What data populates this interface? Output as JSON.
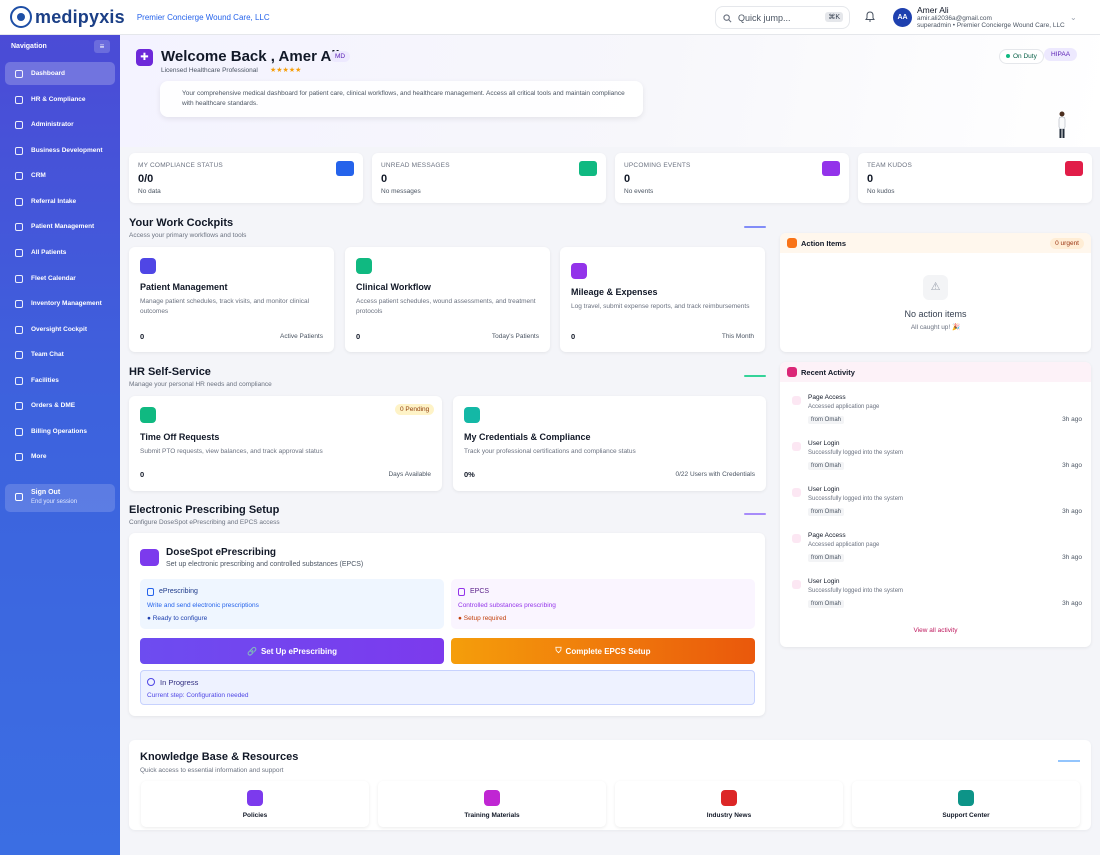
{
  "app": {
    "brand": "medipyxis",
    "org": "Premier Concierge Wound Care, LLC"
  },
  "topbar": {
    "quick_jump_placeholder": "Quick jump...",
    "quick_jump_shortcut": "⌘K",
    "avatar_initials": "AA",
    "user_name": "Amer Ali",
    "user_email": "amir.ali2036a@gmail.com",
    "user_role": "superadmin • Premier Concierge Wound Care, LLC"
  },
  "sidebar": {
    "header": "Navigation",
    "items": [
      {
        "label": "Dashboard",
        "icon": "home-icon"
      },
      {
        "label": "HR & Compliance",
        "icon": "shield-icon"
      },
      {
        "label": "Administrator",
        "icon": "shield-check-icon"
      },
      {
        "label": "Business Development",
        "icon": "trending-up-icon"
      },
      {
        "label": "CRM",
        "icon": "inbox-icon"
      },
      {
        "label": "Referral Intake",
        "icon": "clipboard-icon"
      },
      {
        "label": "Patient Management",
        "icon": "heart-icon"
      },
      {
        "label": "All Patients",
        "icon": "users-icon"
      },
      {
        "label": "Fleet Calendar",
        "icon": "calendar-icon"
      },
      {
        "label": "Inventory Management",
        "icon": "box-icon"
      },
      {
        "label": "Oversight Cockpit",
        "icon": "activity-icon"
      },
      {
        "label": "Team Chat",
        "icon": "chat-icon"
      },
      {
        "label": "Facilities",
        "icon": "building-icon"
      },
      {
        "label": "Orders & DME",
        "icon": "file-icon"
      },
      {
        "label": "Billing Operations",
        "icon": "dollar-icon"
      },
      {
        "label": "More",
        "icon": "more-icon"
      }
    ],
    "sign_out": "Sign Out",
    "sign_out_sub": "End your session"
  },
  "hero": {
    "title": "Welcome Back , Amer Ali!",
    "badge": "MD",
    "subtitle": "Licensed Healthcare Professional",
    "stars": "★★★★★",
    "status": "On Duty",
    "hipaa": "HIPAA",
    "description": "Your comprehensive medical dashboard for patient care, clinical workflows, and healthcare management.",
    "description2": "Access all critical tools and maintain compliance with healthcare standards."
  },
  "stats": [
    {
      "label": "MY COMPLIANCE STATUS",
      "value": "0/0",
      "sub": "No data",
      "color": "#2563eb"
    },
    {
      "label": "UNREAD MESSAGES",
      "value": "0",
      "sub": "No messages",
      "color": "#10b981"
    },
    {
      "label": "UPCOMING EVENTS",
      "value": "0",
      "sub": "No events",
      "color": "#9333ea"
    },
    {
      "label": "TEAM KUDOS",
      "value": "0",
      "sub": "No kudos",
      "color": "#e11d48"
    }
  ],
  "cockpits": {
    "title": "Your Work Cockpits",
    "subtitle": "Access your primary workflows and tools",
    "cards": [
      {
        "title": "Patient Management",
        "desc": "Manage patient schedules, track visits, and monitor clinical outcomes",
        "count": "0",
        "foot": "Active Patients",
        "color": "#4f46e5"
      },
      {
        "title": "Clinical Workflow",
        "desc": "Access patient schedules, wound assessments, and treatment protocols",
        "count": "0",
        "foot": "Today's Patients",
        "color": "#10b981"
      },
      {
        "title": "Mileage & Expenses",
        "desc": "Log travel, submit expense reports, and track reimbursements",
        "count": "0",
        "foot": "This Month",
        "color": "#9333ea"
      }
    ]
  },
  "hr": {
    "title": "HR Self-Service",
    "subtitle": "Manage your personal HR needs and compliance",
    "cards": [
      {
        "title": "Time Off Requests",
        "desc": "Submit PTO requests, view balances, and track approval status",
        "count": "0",
        "foot": "Days Available",
        "badge": "0 Pending",
        "color": "#10b981"
      },
      {
        "title": "My Credentials & Compliance",
        "desc": "Track your professional certifications and compliance status",
        "count": "0%",
        "foot": "0/22 Users with Credentials",
        "color": "#14b8a6"
      }
    ]
  },
  "eprescribing": {
    "title": "Electronic Prescribing Setup",
    "subtitle": "Configure DoseSpot ePrescribing and EPCS access",
    "card_title": "DoseSpot ePrescribing",
    "card_sub": "Set up electronic prescribing and controlled substances (EPCS)",
    "erx_title": "ePrescribing",
    "erx_sub": "Write and send electronic prescriptions",
    "erx_status": "● Ready to configure",
    "epcs_title": "EPCS",
    "epcs_sub": "Controlled substances prescribing",
    "epcs_status": "● Setup required",
    "btn_erx": "Set Up ePrescribing",
    "btn_epcs": "Complete EPCS Setup",
    "progress_title": "In Progress",
    "progress_sub": "Current step: Configuration needed"
  },
  "action_items": {
    "title": "Action Items",
    "badge": "0 urgent",
    "empty": "No action items",
    "empty_sub": "All caught up! 🎉"
  },
  "recent_activity": {
    "title": "Recent Activity",
    "items": [
      {
        "title": "Page Access",
        "desc": "Accessed application page",
        "from": "from Omah",
        "time": "3h ago"
      },
      {
        "title": "User Login",
        "desc": "Successfully logged into the system",
        "from": "from Omah",
        "time": "3h ago"
      },
      {
        "title": "User Login",
        "desc": "Successfully logged into the system",
        "from": "from Omah",
        "time": "3h ago"
      },
      {
        "title": "Page Access",
        "desc": "Accessed application page",
        "from": "from Omah",
        "time": "3h ago"
      },
      {
        "title": "User Login",
        "desc": "Successfully logged into the system",
        "from": "from Omah",
        "time": "3h ago"
      }
    ],
    "view_all": "View all activity"
  },
  "knowledge": {
    "title": "Knowledge Base & Resources",
    "subtitle": "Quick access to essential information and support",
    "items": [
      {
        "label": "Policies",
        "color": "#7c3aed"
      },
      {
        "label": "Training Materials",
        "color": "#c026d3"
      },
      {
        "label": "Industry News",
        "color": "#dc2626"
      },
      {
        "label": "Support Center",
        "color": "#0d9488"
      }
    ]
  }
}
